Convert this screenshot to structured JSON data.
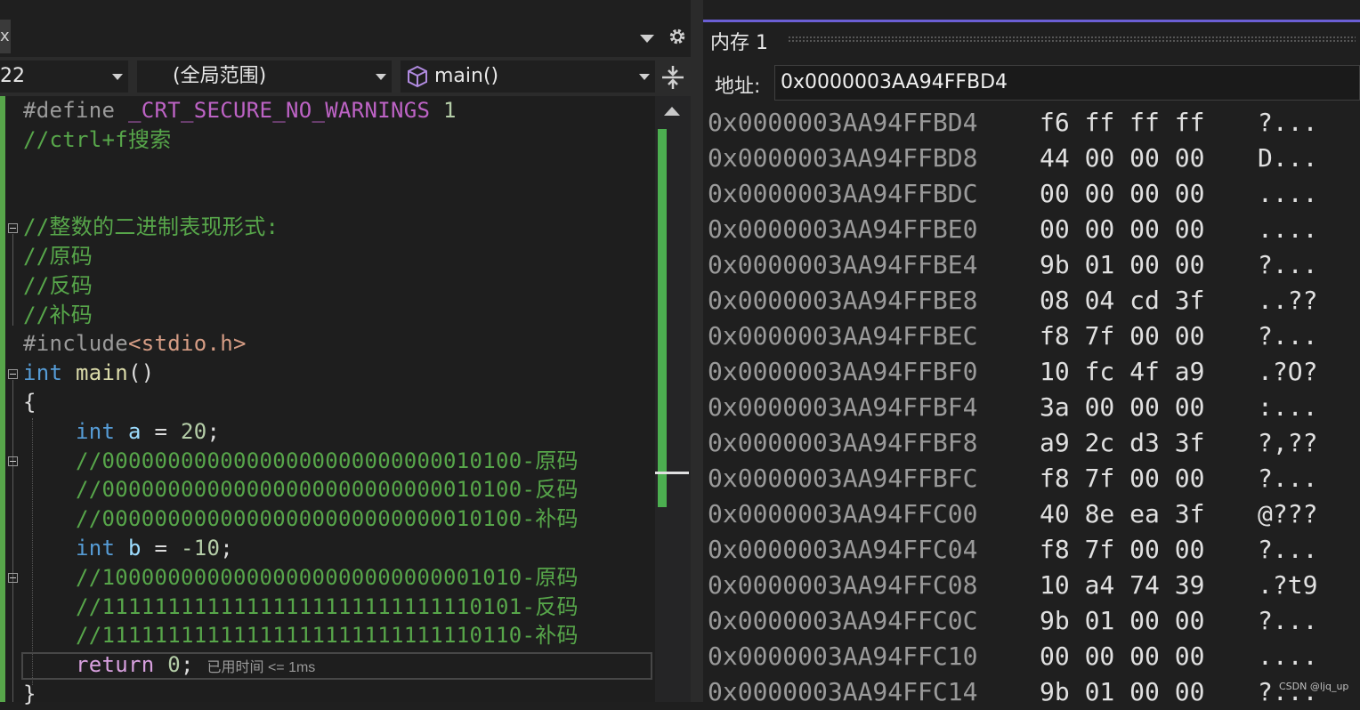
{
  "editor": {
    "tab_stub": "x",
    "line_number_combo": "22",
    "scope_combo": "(全局范围)",
    "function_combo": "main()",
    "lines": [
      {
        "key": "l1",
        "parts": [
          {
            "c": "pp",
            "t": "#define "
          },
          {
            "c": "mac",
            "t": "_CRT_SECURE_NO_WARNINGS"
          },
          {
            "c": "num",
            "t": " 1"
          }
        ]
      },
      {
        "key": "l2",
        "parts": [
          {
            "c": "cm",
            "t": "//ctrl+f搜索"
          }
        ]
      },
      {
        "key": "l3",
        "parts": []
      },
      {
        "key": "l4",
        "parts": []
      },
      {
        "key": "l5",
        "parts": [
          {
            "c": "cm",
            "t": "//整数的二进制表现形式:"
          }
        ]
      },
      {
        "key": "l6",
        "parts": [
          {
            "c": "cm",
            "t": "//原码"
          }
        ]
      },
      {
        "key": "l7",
        "parts": [
          {
            "c": "cm",
            "t": "//反码"
          }
        ]
      },
      {
        "key": "l8",
        "parts": [
          {
            "c": "cm",
            "t": "//补码"
          }
        ]
      },
      {
        "key": "l9",
        "parts": [
          {
            "c": "pp",
            "t": "#include"
          },
          {
            "c": "str",
            "t": "<stdio.h>"
          }
        ]
      },
      {
        "key": "l10",
        "parts": [
          {
            "c": "kw",
            "t": "int"
          },
          {
            "c": "plain",
            "t": " "
          },
          {
            "c": "fn",
            "t": "main"
          },
          {
            "c": "plain",
            "t": "()"
          }
        ]
      },
      {
        "key": "l11",
        "parts": [
          {
            "c": "plain",
            "t": "{"
          }
        ]
      },
      {
        "key": "l12",
        "parts": [
          {
            "c": "plain",
            "t": "    "
          },
          {
            "c": "kw",
            "t": "int"
          },
          {
            "c": "plain",
            "t": " "
          },
          {
            "c": "var",
            "t": "a"
          },
          {
            "c": "plain",
            "t": " = "
          },
          {
            "c": "num",
            "t": "20"
          },
          {
            "c": "plain",
            "t": ";"
          }
        ]
      },
      {
        "key": "l13",
        "parts": [
          {
            "c": "plain",
            "t": "    "
          },
          {
            "c": "cm",
            "t": "//00000000000000000000000000010100-原码"
          }
        ]
      },
      {
        "key": "l14",
        "parts": [
          {
            "c": "plain",
            "t": "    "
          },
          {
            "c": "cm",
            "t": "//00000000000000000000000000010100-反码"
          }
        ]
      },
      {
        "key": "l15",
        "parts": [
          {
            "c": "plain",
            "t": "    "
          },
          {
            "c": "cm",
            "t": "//00000000000000000000000000010100-补码"
          }
        ]
      },
      {
        "key": "l16",
        "parts": [
          {
            "c": "plain",
            "t": "    "
          },
          {
            "c": "kw",
            "t": "int"
          },
          {
            "c": "plain",
            "t": " "
          },
          {
            "c": "var",
            "t": "b"
          },
          {
            "c": "plain",
            "t": " = "
          },
          {
            "c": "num",
            "t": "-10"
          },
          {
            "c": "plain",
            "t": ";"
          }
        ]
      },
      {
        "key": "l17",
        "parts": [
          {
            "c": "plain",
            "t": "    "
          },
          {
            "c": "cm",
            "t": "//10000000000000000000000000001010-原码"
          }
        ]
      },
      {
        "key": "l18",
        "parts": [
          {
            "c": "plain",
            "t": "    "
          },
          {
            "c": "cm",
            "t": "//11111111111111111111111111110101-反码"
          }
        ]
      },
      {
        "key": "l19",
        "parts": [
          {
            "c": "plain",
            "t": "    "
          },
          {
            "c": "cm",
            "t": "//11111111111111111111111111110110-补码"
          }
        ]
      },
      {
        "key": "l20",
        "parts": [
          {
            "c": "plain",
            "t": "    "
          },
          {
            "c": "ctl",
            "t": "return"
          },
          {
            "c": "plain",
            "t": " "
          },
          {
            "c": "num",
            "t": "0"
          },
          {
            "c": "plain",
            "t": "; "
          },
          {
            "c": "hint",
            "t": "已用时间 <= 1ms"
          }
        ]
      },
      {
        "key": "l21",
        "parts": [
          {
            "c": "plain",
            "t": "}"
          }
        ]
      }
    ]
  },
  "memory": {
    "title": "内存 1",
    "address_label": "地址:",
    "address_value": "0x0000003AA94FFBD4",
    "rows": [
      {
        "addr": "0x0000003AA94FFBD4",
        "hex": "f6 ff ff ff",
        "ascii": "?..."
      },
      {
        "addr": "0x0000003AA94FFBD8",
        "hex": "44 00 00 00",
        "ascii": "D..."
      },
      {
        "addr": "0x0000003AA94FFBDC",
        "hex": "00 00 00 00",
        "ascii": "...."
      },
      {
        "addr": "0x0000003AA94FFBE0",
        "hex": "00 00 00 00",
        "ascii": "...."
      },
      {
        "addr": "0x0000003AA94FFBE4",
        "hex": "9b 01 00 00",
        "ascii": "?..."
      },
      {
        "addr": "0x0000003AA94FFBE8",
        "hex": "08 04 cd 3f",
        "ascii": "..??"
      },
      {
        "addr": "0x0000003AA94FFBEC",
        "hex": "f8 7f 00 00",
        "ascii": "?..."
      },
      {
        "addr": "0x0000003AA94FFBF0",
        "hex": "10 fc 4f a9",
        "ascii": ".?O?"
      },
      {
        "addr": "0x0000003AA94FFBF4",
        "hex": "3a 00 00 00",
        "ascii": ":..."
      },
      {
        "addr": "0x0000003AA94FFBF8",
        "hex": "a9 2c d3 3f",
        "ascii": "?,??"
      },
      {
        "addr": "0x0000003AA94FFBFC",
        "hex": "f8 7f 00 00",
        "ascii": "?..."
      },
      {
        "addr": "0x0000003AA94FFC00",
        "hex": "40 8e ea 3f",
        "ascii": "@???"
      },
      {
        "addr": "0x0000003AA94FFC04",
        "hex": "f8 7f 00 00",
        "ascii": "?..."
      },
      {
        "addr": "0x0000003AA94FFC08",
        "hex": "10 a4 74 39",
        "ascii": ".?t9"
      },
      {
        "addr": "0x0000003AA94FFC0C",
        "hex": "9b 01 00 00",
        "ascii": "?..."
      },
      {
        "addr": "0x0000003AA94FFC10",
        "hex": "00 00 00 00",
        "ascii": "...."
      },
      {
        "addr": "0x0000003AA94FFC14",
        "hex": "9b 01 00 00",
        "ascii": "?..."
      }
    ]
  },
  "watermark": "CSDN @ljq_up",
  "colors": {
    "accent": "#6b5fd4",
    "scroll_thumb": "#4caf50",
    "comment": "#57a64a",
    "keyword": "#569cd6"
  }
}
